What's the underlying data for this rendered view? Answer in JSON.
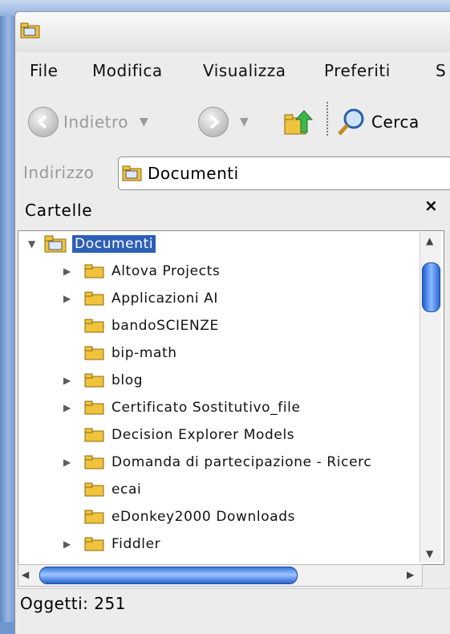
{
  "menu": {
    "items": [
      "File",
      "Modifica",
      "Visualizza",
      "Preferiti",
      "S"
    ]
  },
  "toolbar": {
    "back_label": "Indietro",
    "search_label": "Cerca"
  },
  "address": {
    "label": "Indirizzo",
    "value": "Documenti"
  },
  "panel": {
    "title": "Cartelle",
    "close_glyph": "×"
  },
  "tree": {
    "root": "Documenti",
    "items": [
      "Altova Projects",
      "Applicazioni AI",
      "bandoSCIENZE",
      "bip-math",
      "blog",
      "Certificato Sostitutivo_file",
      "Decision Explorer Models",
      "Domanda di partecipazione - Ricerc",
      "ecai",
      "eDonkey2000 Downloads",
      "Fiddler"
    ]
  },
  "status": {
    "text": "Oggetti: 251"
  }
}
